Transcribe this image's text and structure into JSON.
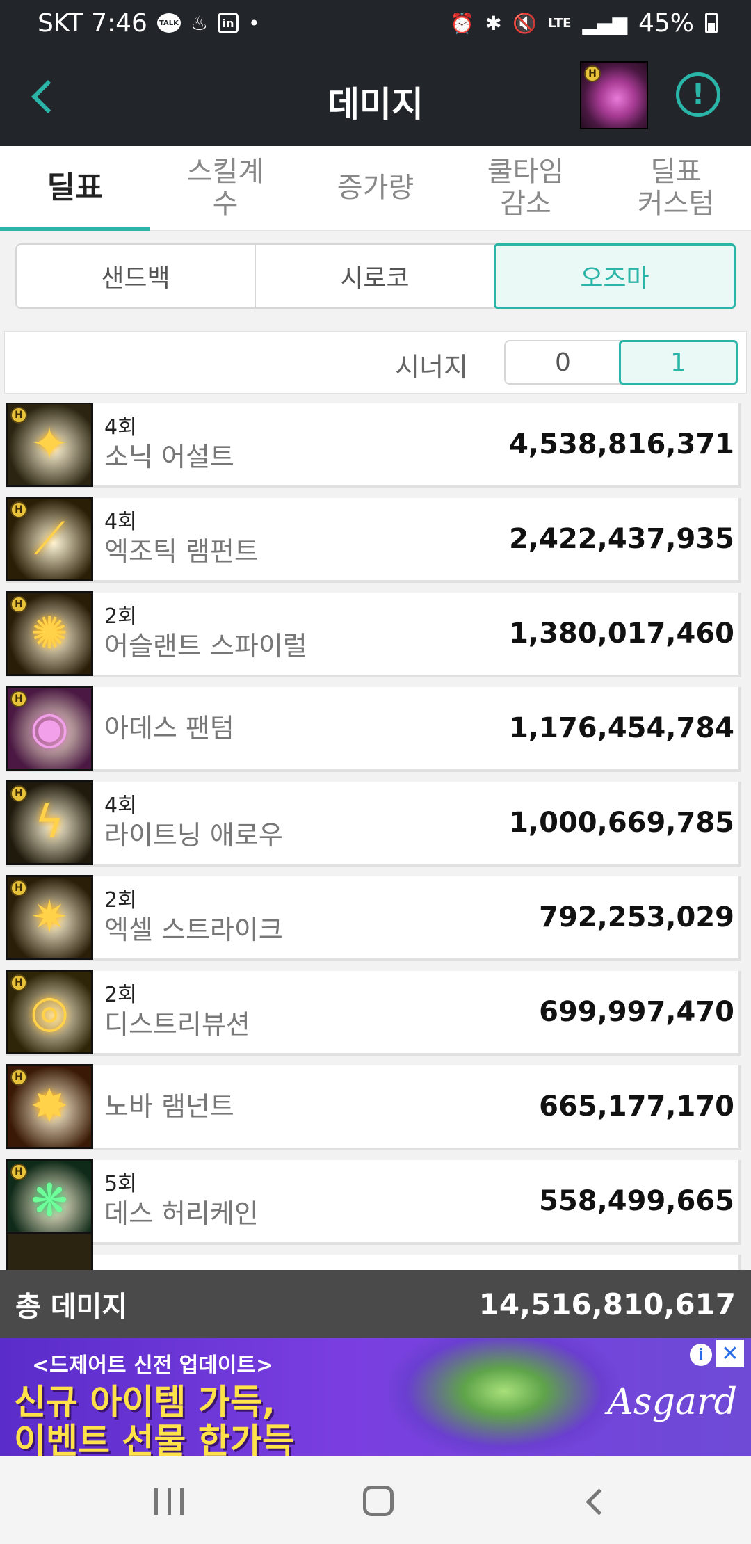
{
  "status_bar": {
    "carrier_time": "SKT 7:46",
    "talk_label": "TALK",
    "box_label": "in",
    "dot": "•",
    "network": "LTE",
    "battery": "45%"
  },
  "app_bar": {
    "title": "데미지",
    "alert_symbol": "!"
  },
  "tabs": [
    {
      "label": "딜표",
      "active": true
    },
    {
      "label": "스킬계\n수",
      "active": false
    },
    {
      "label": "증가량",
      "active": false
    },
    {
      "label": "쿨타임\n감소",
      "active": false
    },
    {
      "label": "딜표\n커스텀",
      "active": false
    }
  ],
  "dungeons": [
    {
      "label": "샌드백",
      "active": false
    },
    {
      "label": "시로코",
      "active": false
    },
    {
      "label": "오즈마",
      "active": true
    }
  ],
  "synergy": {
    "label": "시너지",
    "options": [
      {
        "label": "0",
        "active": false
      },
      {
        "label": "1",
        "active": true
      }
    ]
  },
  "skills": [
    {
      "count": "4회",
      "name": "소닉 어설트",
      "damage": "4,538,816,371",
      "icon": "sonic-assault-icon",
      "color": "#2b2410"
    },
    {
      "count": "4회",
      "name": "엑조틱 램펀트",
      "damage": "2,422,437,935",
      "icon": "exotic-rampant-icon",
      "color": "#2a1f06"
    },
    {
      "count": "2회",
      "name": "어슬랜트 스파이럴",
      "damage": "1,380,017,460",
      "icon": "aslant-spiral-icon",
      "color": "#2a1d08"
    },
    {
      "count": "",
      "name": "아데스 팬텀",
      "damage": "1,176,454,784",
      "icon": "ades-phantom-icon",
      "color": "#4a1842"
    },
    {
      "count": "4회",
      "name": "라이트닝 애로우",
      "damage": "1,000,669,785",
      "icon": "lightning-arrow-icon",
      "color": "#1f1a0c"
    },
    {
      "count": "2회",
      "name": "엑셀 스트라이크",
      "damage": "792,253,029",
      "icon": "excel-strike-icon",
      "color": "#2a1e08"
    },
    {
      "count": "2회",
      "name": "디스트리뷰션",
      "damage": "699,997,470",
      "icon": "distribution-icon",
      "color": "#2e2408"
    },
    {
      "count": "",
      "name": "노바 램넌트",
      "damage": "665,177,170",
      "icon": "nova-remnant-icon",
      "color": "#3a1a06"
    },
    {
      "count": "5회",
      "name": "데스 허리케인",
      "damage": "558,499,665",
      "icon": "death-hurricane-icon",
      "color": "#0f2a18"
    }
  ],
  "total": {
    "label": "총 데미지",
    "value": "14,516,810,617"
  },
  "ad": {
    "small_text": "<드제어트 신전 업데이트>",
    "line1": "신규 아이템 가득,",
    "line2": "이벤트 선물 한가득",
    "brand": "Asgard",
    "info_symbol": "i",
    "close_symbol": "✕"
  }
}
